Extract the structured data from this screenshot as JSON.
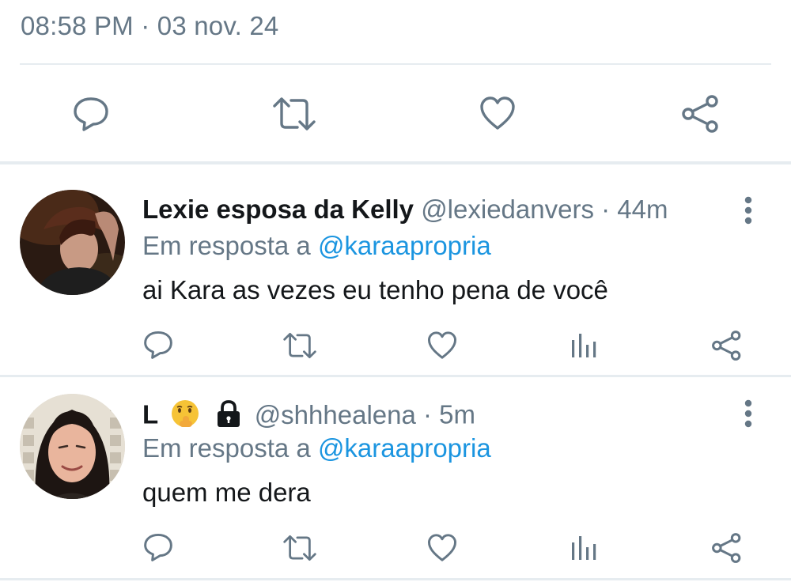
{
  "header": {
    "timestamp": "08:58 PM · 03 nov. 24"
  },
  "main_actions": {
    "icons": [
      "reply-icon",
      "retweet-icon",
      "like-icon",
      "share-icon"
    ]
  },
  "replies": [
    {
      "name": "Lexie esposa da Kelly",
      "handle": "@lexiedanvers",
      "time_sep": " · ",
      "time": "44m",
      "reply_prefix": "Em resposta a ",
      "reply_to": "@karaapropria",
      "text": "ai Kara as vezes eu tenho pena de você",
      "actions": [
        "reply-icon",
        "retweet-icon",
        "like-icon",
        "analytics-icon",
        "share-icon"
      ]
    },
    {
      "name": "L",
      "handle": "@shhhealena",
      "time_sep": " · ",
      "time": "5m",
      "reply_prefix": "Em resposta a ",
      "reply_to": "@karaapropria",
      "text": "quem me dera",
      "actions": [
        "reply-icon",
        "retweet-icon",
        "like-icon",
        "analytics-icon",
        "share-icon"
      ]
    }
  ],
  "colors": {
    "text_primary": "#14171a",
    "text_secondary": "#657786",
    "link": "#1b95e0",
    "divider": "#e6ecf0",
    "icon": "#657786"
  }
}
